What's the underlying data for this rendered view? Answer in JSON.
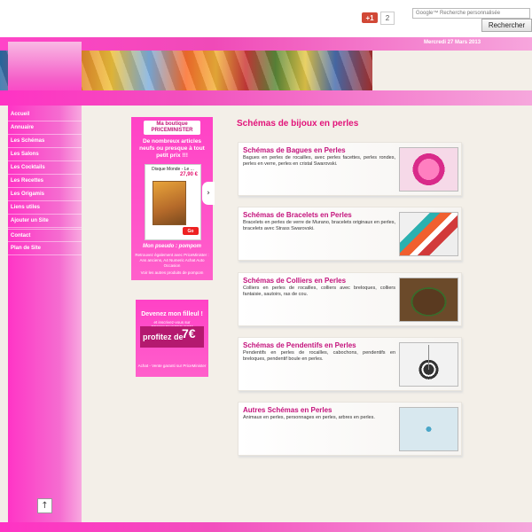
{
  "header": {
    "gplus_label": "+1",
    "gplus_count": "2",
    "search_placeholder": "Google™ Recherche personnalisée",
    "search_button": "Rechercher",
    "date": "Mercredi 27 Mars 2013"
  },
  "sidebar": {
    "items": [
      "Accueil",
      "Annuaire",
      "Les Schémas",
      "Les Salons",
      "Les Cocktails",
      "Les Recettes",
      "Les Origamis",
      "Liens utiles",
      "Ajouter un Site",
      "Contact",
      "Plan de Site"
    ],
    "scroll_top": "↑"
  },
  "ad1": {
    "logo_line1": "Ma boutique",
    "logo_line2": "PRICEMINISTER",
    "headline": "De nombreux articles neufs ou presque à tout petit prix !!!",
    "product_title": "Disque Monde - Le ...",
    "product_price": "27,90 €",
    "go": "Go",
    "arrow": "›",
    "pseudo": "Mon pseudo : pompom",
    "small": "Retrouvez également avec PriceMinister : Ans anciens, A4 Numeric Achat Auto Occasion",
    "link": "Voir les autres produits de pompom"
  },
  "ad2": {
    "headline": "Devenez mon filleul !",
    "sub": "et inscrivez-vous sur PRICEMINISTER.COM",
    "promo": "profitez de",
    "euro": "7€",
    "foot": "Achat - Vente garanti sur PriceMinister"
  },
  "main": {
    "title": "Schémas de bijoux en perles",
    "cards": [
      {
        "title": "Schémas de Bagues en Perles",
        "desc": "Bagues en perles de rocailles, avec perles facettes, perles rondes, perles en verre, perles en cristal Swarovski.",
        "image": "ring-image"
      },
      {
        "title": "Schémas de Bracelets en Perles",
        "desc": "Bracelets en perles de verre de Murano, bracelets originaux en perles, bracelets avec Strass Swarovski.",
        "image": "bracelet-image"
      },
      {
        "title": "Schémas de Colliers en Perles",
        "desc": "Colliers en perles de rocailles, colliers avec breloques, colliers fantaisie, sautoirs, ras de cou.",
        "image": "necklace-image"
      },
      {
        "title": "Schémas de Pendentifs en Perles",
        "desc": "Pendentifs en perles de rocailles, cabochons, pendentifs en breloques, pendentif boule en perles.",
        "image": "pendant-image"
      },
      {
        "title": "Autres Schémas en Perles",
        "desc": "Animaux en perles, personnages en perles, arbres en perles.",
        "image": "dragonfly-image"
      }
    ]
  },
  "colors": {
    "accent": "#e2137a",
    "pink": "#ff33c4",
    "background": "#f3efe8"
  }
}
